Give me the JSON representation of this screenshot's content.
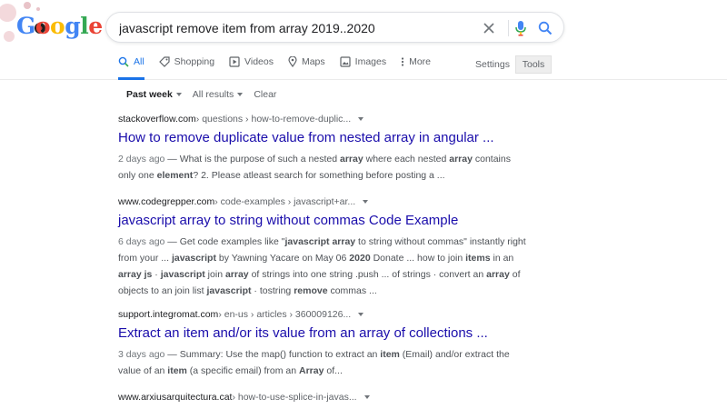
{
  "logo": {
    "text": "Google",
    "colors": [
      "#4285f4",
      "#ea4335",
      "#fbbc05",
      "#4285f4",
      "#34a853",
      "#ea4335"
    ]
  },
  "search": {
    "query": "javascript remove item from array 2019..2020"
  },
  "tabs": [
    {
      "label": "All",
      "icon": "search-icon",
      "active": true
    },
    {
      "label": "Shopping",
      "icon": "tag-icon",
      "active": false
    },
    {
      "label": "Videos",
      "icon": "play-icon",
      "active": false
    },
    {
      "label": "Maps",
      "icon": "map-pin-icon",
      "active": false
    },
    {
      "label": "Images",
      "icon": "image-icon",
      "active": false
    },
    {
      "label": "More",
      "icon": "more-dots-icon",
      "active": false
    }
  ],
  "settings_label": "Settings",
  "tools_label": "Tools",
  "filters": {
    "time": "Past week",
    "results": "All results",
    "clear": "Clear"
  },
  "results": [
    {
      "site": "stackoverflow.com",
      "path": " › questions › how-to-remove-duplic...",
      "title": "How to remove duplicate value from nested array in angular ...",
      "date": "2 days ago",
      "snippet_lines": [
        " — What is the purpose of such a nested array where each nested array contains",
        "only one element? 2. Please atleast search for something before posting a ..."
      ]
    },
    {
      "site": "www.codegrepper.com",
      "path": " › code-examples › javascript+ar...",
      "title": "javascript array to string without commas Code Example",
      "date": "6 days ago",
      "snippet_lines": [
        " — Get code examples like \"javascript array to string without commas\" instantly right",
        "from your ... javascript by Yawning Yacare on May 06 2020 Donate ... how to join items in an",
        "array js · javascript join array of strings into one string .push ... of strings · convert an array of",
        "objects to an join list javascript · tostring remove commas ..."
      ]
    },
    {
      "site": "support.integromat.com",
      "path": " › en-us › articles › 360009126...",
      "title": "Extract an item and/or its value from an array of collections ...",
      "date": "3 days ago",
      "snippet_lines": [
        " — Summary: Use the map() function to extract an item (Email) and/or extract the",
        "value of an item (a specific email) from an Array of..."
      ]
    },
    {
      "site": "www.arxiusarquitectura.cat",
      "path": " › how-to-use-splice-in-javas...",
      "title": "",
      "date": "",
      "snippet_lines": []
    }
  ]
}
